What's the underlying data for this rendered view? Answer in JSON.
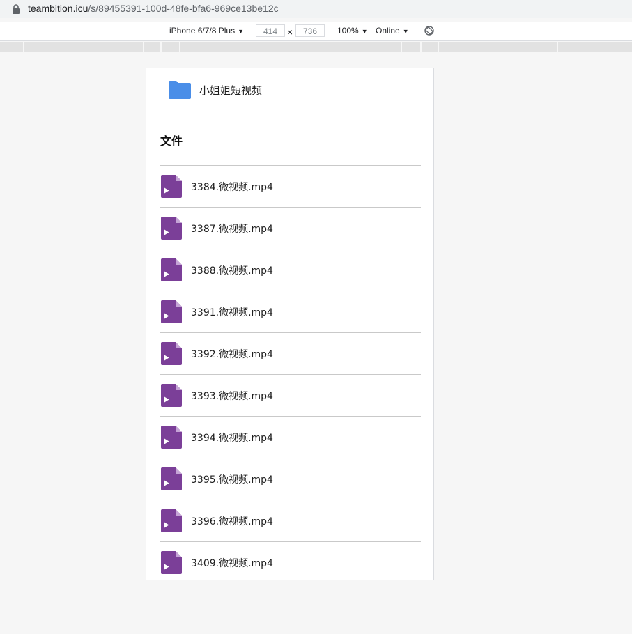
{
  "browser": {
    "url_host": "teambition.icu",
    "url_path": "/s/89455391-100d-48fe-bfa6-969ce13be12c"
  },
  "device_toolbar": {
    "device": "iPhone 6/7/8 Plus",
    "width": "414",
    "times": "×",
    "height": "736",
    "zoom": "100%",
    "network": "Online",
    "caret": "▼"
  },
  "page": {
    "folder_name": "小姐姐短视频",
    "section_title": "文件",
    "files": [
      {
        "name": "3384.微视频.mp4"
      },
      {
        "name": "3387.微视频.mp4"
      },
      {
        "name": "3388.微视频.mp4"
      },
      {
        "name": "3391.微视频.mp4"
      },
      {
        "name": "3392.微视频.mp4"
      },
      {
        "name": "3393.微视频.mp4"
      },
      {
        "name": "3394.微视频.mp4"
      },
      {
        "name": "3395.微视频.mp4"
      },
      {
        "name": "3396.微视频.mp4"
      },
      {
        "name": "3409.微视频.mp4"
      }
    ]
  },
  "icons": {
    "folder": "folder-icon",
    "video_file": "video-file-icon",
    "lock": "lock-icon",
    "rotate": "rotate-icon"
  },
  "colors": {
    "folder_blue": "#4a8ee8",
    "video_purple": "#7b3f98",
    "video_fold": "#c5a4d6",
    "background": "#f6f6f6"
  }
}
